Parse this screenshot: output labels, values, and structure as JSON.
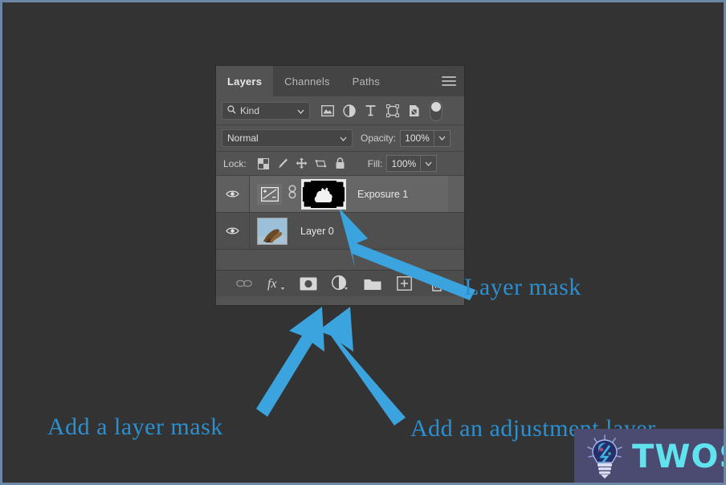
{
  "window": {
    "background_color": "#333333",
    "border_color": "#6e86a6"
  },
  "panel": {
    "name": "layers-panel",
    "background_color": "#535353",
    "tabs": [
      {
        "label": "Layers",
        "active": true
      },
      {
        "label": "Channels",
        "active": false
      },
      {
        "label": "Paths",
        "active": false
      }
    ],
    "menu_icon": "hamburger-menu-icon",
    "filter_row": {
      "kind_label": "Kind",
      "search_icon": "search-icon",
      "chevron_icon": "chevron-down-icon",
      "filter_icons": [
        "image-layer-filter-icon",
        "adjustment-layer-filter-icon",
        "type-layer-filter-icon",
        "shape-layer-filter-icon",
        "smart-object-filter-icon"
      ],
      "toggle_icon": "filter-enable-toggle"
    },
    "blend_row": {
      "blend_mode": "Normal",
      "opacity_label": "Opacity:",
      "opacity_value": "100%"
    },
    "lock_row": {
      "lock_label": "Lock:",
      "lock_icons": [
        "lock-transparent-pixels-icon",
        "lock-image-pixels-icon",
        "lock-position-icon",
        "lock-artboard-nesting-icon",
        "lock-all-icon"
      ],
      "fill_label": "Fill:",
      "fill_value": "100%"
    },
    "layers": [
      {
        "name": "Exposure 1",
        "visible": true,
        "selected": true,
        "visibility_icon": "eye-icon",
        "adjustment_icon": "exposure-adjustment-icon",
        "link_icon": "link-mask-icon",
        "thumbnail": "layer-mask-thumbnail"
      },
      {
        "name": "Layer 0",
        "visible": true,
        "selected": false,
        "visibility_icon": "eye-icon",
        "thumbnail": "layer-image-thumbnail"
      }
    ],
    "toolbar_buttons": [
      {
        "icon": "link-layers-icon",
        "label": "Link layers",
        "disabled": true
      },
      {
        "icon": "fx-layer-style-icon",
        "label": "Add a layer style",
        "disabled": false
      },
      {
        "icon": "add-layer-mask-icon",
        "label": "Add a layer mask",
        "disabled": false
      },
      {
        "icon": "new-adjustment-layer-icon",
        "label": "Create new fill or adjustment layer",
        "disabled": false
      },
      {
        "icon": "new-group-icon",
        "label": "Create a new group",
        "disabled": false
      },
      {
        "icon": "new-layer-icon",
        "label": "Create a new layer",
        "disabled": false
      },
      {
        "icon": "delete-layer-icon",
        "label": "Delete layer",
        "disabled": false
      }
    ]
  },
  "annotations": {
    "color": "#2b8fd0",
    "arrow_color": "#3ba3dd",
    "items": [
      {
        "id": "layer-mask",
        "text": "Layer mask"
      },
      {
        "id": "add-a-layer-mask",
        "text": "Add a layer mask"
      },
      {
        "id": "add-an-adjustment-layer",
        "text": "Add an adjustment layer"
      }
    ]
  },
  "watermark": {
    "text": "TWOS",
    "icon": "lightbulb-icon",
    "background_color": "#4b4b72",
    "text_color": "#5fe3ee"
  }
}
